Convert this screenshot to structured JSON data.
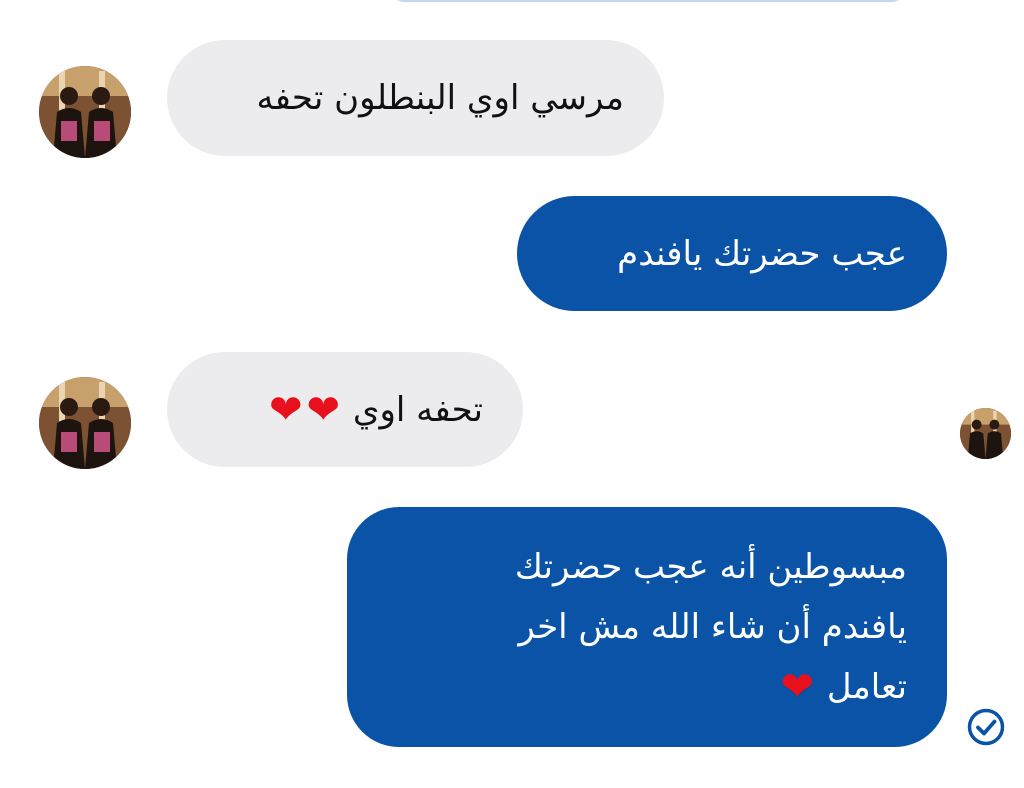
{
  "conversation": {
    "messages": [
      {
        "direction": "incoming",
        "text": "مرسي اوي البنطلون تحفه"
      },
      {
        "direction": "outgoing",
        "text": "عجب حضرتك يافندم"
      },
      {
        "direction": "incoming",
        "text": "تحفه اوي",
        "emoji": [
          "heart",
          "heart"
        ]
      },
      {
        "direction": "outgoing",
        "lines": [
          "مبسوطين أنه عجب حضرتك",
          "يافندم أن شاء الله مش اخر",
          "تعامل"
        ],
        "emoji": [
          "heart"
        ]
      }
    ],
    "status": {
      "icon": "read-check-icon",
      "state": "read"
    },
    "read_receipt_avatar": "contact-avatar"
  },
  "colors": {
    "incoming_bubble": "#ececee",
    "outgoing_bubble": "#0a53a7",
    "outgoing_text": "#ffffff",
    "heart": "#e8101c",
    "check": "#0a53a7"
  },
  "icons": {
    "heart": "❤️",
    "check": "circle-check-icon"
  }
}
